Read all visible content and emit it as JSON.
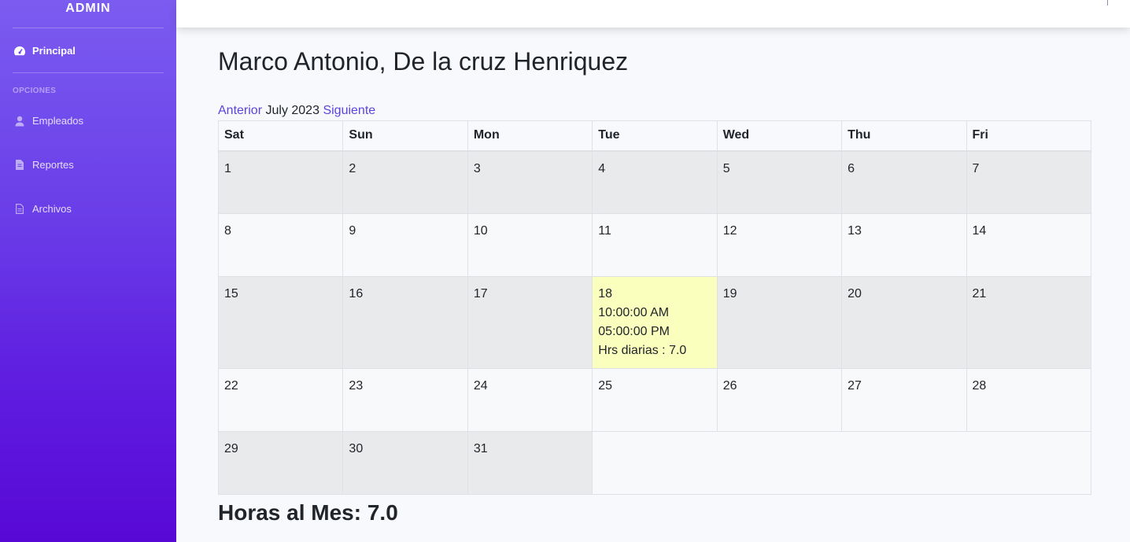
{
  "sidebar": {
    "brand": "ADMIN",
    "principal": "Principal",
    "section": "OPCIONES",
    "items": [
      {
        "label": "Empleados",
        "icon": "user-icon"
      },
      {
        "label": "Reportes",
        "icon": "file-icon"
      },
      {
        "label": "Archivos",
        "icon": "document-icon"
      }
    ]
  },
  "main": {
    "title": "Marco Antonio, De la cruz Henriquez",
    "nav": {
      "prev": "Anterior",
      "month": "July 2023",
      "next": "Siguiente"
    },
    "days": [
      "Sat",
      "Sun",
      "Mon",
      "Tue",
      "Wed",
      "Thu",
      "Fri"
    ],
    "entry": {
      "date": "18",
      "in": "10:00:00 AM",
      "out": "05:00:00 PM",
      "hours": "Hrs diarias : 7.0"
    },
    "total": "Horas al Mes: 7.0"
  },
  "colors": {
    "accent": "#5a44e0",
    "highlight": "#fbffbe",
    "sidebar_top": "#7b5cf0",
    "sidebar_bottom": "#5808d6"
  }
}
